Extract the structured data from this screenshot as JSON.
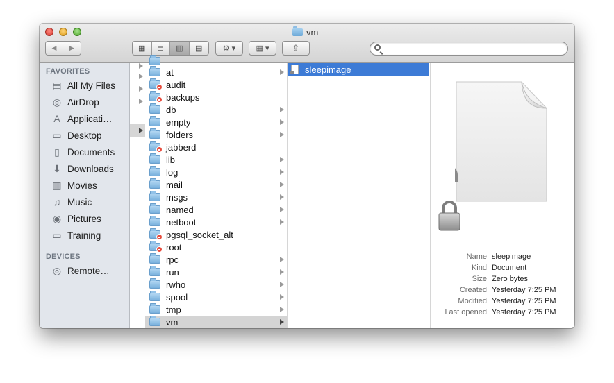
{
  "window": {
    "title": "vm"
  },
  "toolbar": {
    "back_label": "◀",
    "forward_label": "▶",
    "view_icons": "▦",
    "view_list": "≡",
    "view_columns": "▥",
    "view_coverflow": "▤",
    "action_label": "⚙ ▾",
    "arrange_label": "▦ ▾",
    "share_label": "⇪",
    "search_placeholder": ""
  },
  "sidebar": {
    "favorites_header": "FAVORITES",
    "devices_header": "DEVICES",
    "favorites": [
      {
        "label": "All My Files",
        "icon": "all-files-icon",
        "glyph": "▤"
      },
      {
        "label": "AirDrop",
        "icon": "airdrop-icon",
        "glyph": "◎"
      },
      {
        "label": "Applicati…",
        "icon": "applications-icon",
        "glyph": "A"
      },
      {
        "label": "Desktop",
        "icon": "desktop-icon",
        "glyph": "▭"
      },
      {
        "label": "Documents",
        "icon": "documents-icon",
        "glyph": "▯"
      },
      {
        "label": "Downloads",
        "icon": "downloads-icon",
        "glyph": "⬇"
      },
      {
        "label": "Movies",
        "icon": "movies-icon",
        "glyph": "▥"
      },
      {
        "label": "Music",
        "icon": "music-icon",
        "glyph": "♫"
      },
      {
        "label": "Pictures",
        "icon": "pictures-icon",
        "glyph": "◉"
      },
      {
        "label": "Training",
        "icon": "folder-icon",
        "glyph": "▭"
      }
    ],
    "devices": [
      {
        "label": "Remote…",
        "icon": "disc-icon",
        "glyph": "◎"
      }
    ]
  },
  "column2": {
    "items": [
      {
        "name": "at",
        "badge": false,
        "arrow": true
      },
      {
        "name": "audit",
        "badge": true,
        "arrow": false
      },
      {
        "name": "backups",
        "badge": true,
        "arrow": false
      },
      {
        "name": "db",
        "badge": false,
        "arrow": true
      },
      {
        "name": "empty",
        "badge": false,
        "arrow": true
      },
      {
        "name": "folders",
        "badge": false,
        "arrow": true
      },
      {
        "name": "jabberd",
        "badge": true,
        "arrow": false
      },
      {
        "name": "lib",
        "badge": false,
        "arrow": true
      },
      {
        "name": "log",
        "badge": false,
        "arrow": true
      },
      {
        "name": "mail",
        "badge": false,
        "arrow": true
      },
      {
        "name": "msgs",
        "badge": false,
        "arrow": true
      },
      {
        "name": "named",
        "badge": false,
        "arrow": true
      },
      {
        "name": "netboot",
        "badge": false,
        "arrow": true
      },
      {
        "name": "pgsql_socket_alt",
        "badge": true,
        "arrow": false
      },
      {
        "name": "root",
        "badge": true,
        "arrow": false
      },
      {
        "name": "rpc",
        "badge": false,
        "arrow": true
      },
      {
        "name": "run",
        "badge": false,
        "arrow": true
      },
      {
        "name": "rwho",
        "badge": false,
        "arrow": true
      },
      {
        "name": "spool",
        "badge": false,
        "arrow": true
      },
      {
        "name": "tmp",
        "badge": false,
        "arrow": true
      },
      {
        "name": "vm",
        "badge": false,
        "arrow": true,
        "selected": true
      }
    ]
  },
  "column3": {
    "selected_file": "sleepimage"
  },
  "preview": {
    "rows": [
      {
        "key": "Name",
        "value": "sleepimage"
      },
      {
        "key": "Kind",
        "value": "Document"
      },
      {
        "key": "Size",
        "value": "Zero bytes"
      },
      {
        "key": "Created",
        "value": "Yesterday 7:25 PM"
      },
      {
        "key": "Modified",
        "value": "Yesterday 7:25 PM"
      },
      {
        "key": "Last opened",
        "value": "Yesterday 7:25 PM"
      }
    ]
  },
  "colors": {
    "selection_blue": "#3d7bd6",
    "sidebar_bg": "#e2e6ec",
    "badge_red": "#e84c3d"
  }
}
